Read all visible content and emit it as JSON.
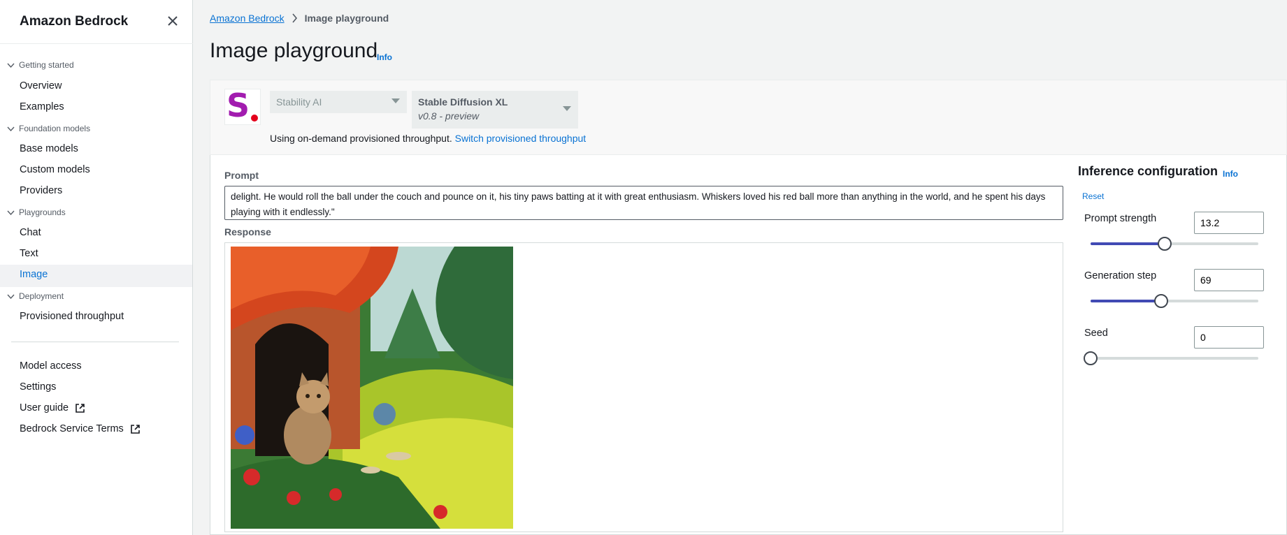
{
  "sidebar": {
    "title": "Amazon Bedrock",
    "sections": [
      {
        "label": "Getting started",
        "items": [
          {
            "label": "Overview"
          },
          {
            "label": "Examples"
          }
        ]
      },
      {
        "label": "Foundation models",
        "items": [
          {
            "label": "Base models"
          },
          {
            "label": "Custom models"
          },
          {
            "label": "Providers"
          }
        ]
      },
      {
        "label": "Playgrounds",
        "items": [
          {
            "label": "Chat"
          },
          {
            "label": "Text"
          },
          {
            "label": "Image"
          }
        ]
      },
      {
        "label": "Deployment",
        "items": [
          {
            "label": "Provisioned throughput"
          }
        ]
      }
    ],
    "footer_items": [
      {
        "label": "Model access"
      },
      {
        "label": "Settings"
      },
      {
        "label": "User guide"
      },
      {
        "label": "Bedrock Service Terms"
      }
    ],
    "active_item": "Image"
  },
  "breadcrumb": {
    "parent": "Amazon Bedrock",
    "current": "Image playground"
  },
  "page": {
    "title": "Image playground",
    "info": "Info"
  },
  "model": {
    "provider": "Stability AI",
    "model_name": "Stable Diffusion XL",
    "model_version": "v0.8 - preview",
    "throughput_text": "Using on-demand provisioned throughput.",
    "throughput_link": "Switch provisioned throughput"
  },
  "prompt": {
    "label": "Prompt",
    "value": "delight. He would roll the ball under the couch and pounce on it, his tiny paws batting at it with great enthusiasm. Whiskers loved his red ball more than anything in the world, and he spent his days playing with it endlessly.\""
  },
  "response": {
    "label": "Response"
  },
  "inference": {
    "title": "Inference configuration",
    "info": "Info",
    "reset": "Reset",
    "params": [
      {
        "label": "Prompt strength",
        "value": "13.2",
        "fraction": 0.44
      },
      {
        "label": "Generation step",
        "value": "69",
        "fraction": 0.42
      },
      {
        "label": "Seed",
        "value": "0",
        "fraction": 0.0
      }
    ]
  },
  "colors": {
    "link": "#0972d3",
    "slider_fill": "#414ab4",
    "logo_s": "#a21caf",
    "logo_dot": "#e4001b"
  }
}
